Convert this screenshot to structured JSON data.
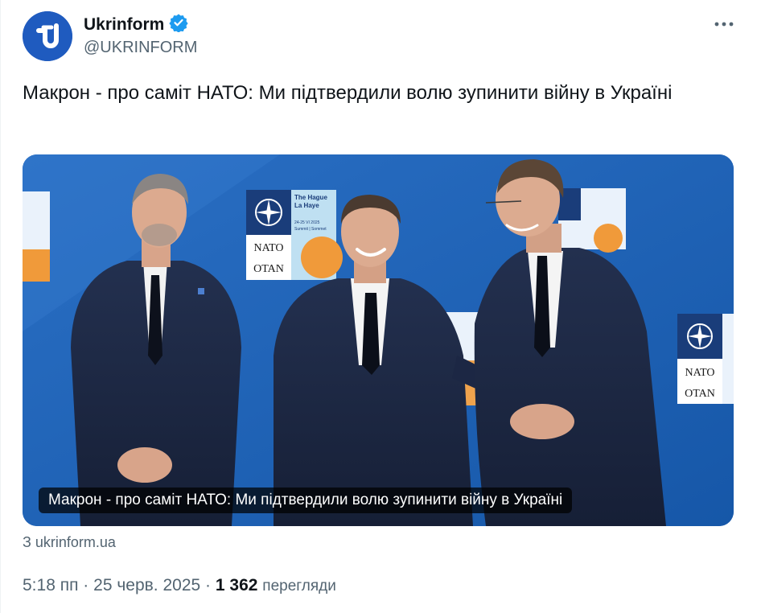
{
  "author": {
    "name": "Ukrinform",
    "handle": "@UKRINFORM",
    "verified": true,
    "avatar_icon": "ukrinform-logo-icon",
    "avatar_color": "#1f5bbf"
  },
  "tweet": {
    "text": "Макрон - про саміт НАТО: Ми підтвердили волю зупинити війну в Україні"
  },
  "card": {
    "caption": "Макрон - про саміт НАТО: Ми підтвердили волю зупинити війну в Україні",
    "domain": "З ukrinform.ua",
    "backdrop": {
      "line1": "The Hague",
      "line2": "La Haye",
      "dates": "24-25 VI 2025",
      "summit": "Summit | Sommet",
      "nato": "NATO",
      "otan": "OTAN"
    }
  },
  "meta": {
    "time": "5:18 пп",
    "sep1": "·",
    "date": "25 черв. 2025",
    "sep2": "·",
    "views_count": "1 362",
    "views_label": "перегляди"
  },
  "colors": {
    "verified_badge": "#1d9bf0",
    "secondary_text": "#536471",
    "backdrop_blue": "#1b62b5"
  },
  "icons": {
    "verified": "verified-badge-icon",
    "more": "more-options-icon"
  }
}
